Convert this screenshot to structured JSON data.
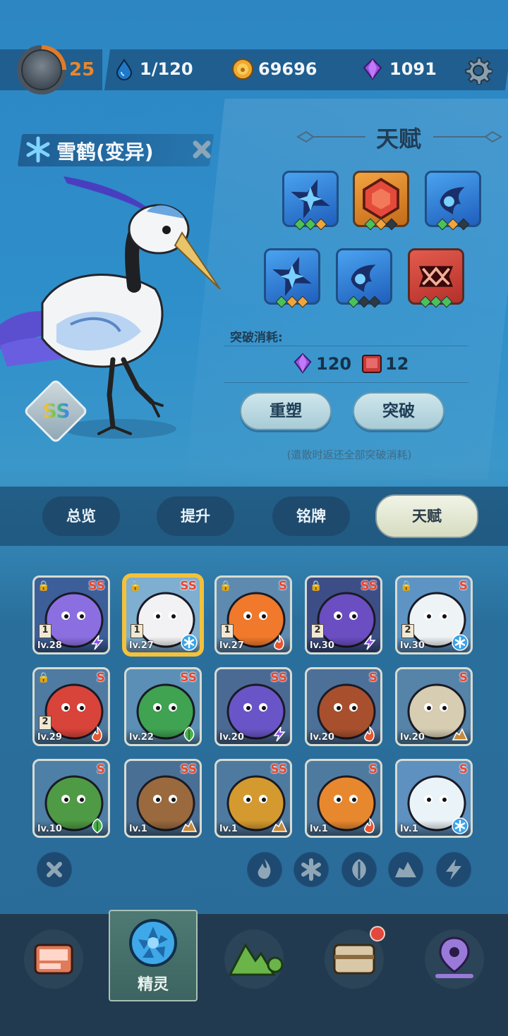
{
  "player": {
    "level": "25"
  },
  "resources": {
    "stamina": "1/120",
    "coins": "69696",
    "gems": "1091"
  },
  "spirit": {
    "name": "雪鹤(变异)",
    "rank": "SS"
  },
  "talent": {
    "title": "天赋",
    "icons": [
      {
        "type": "blue-star",
        "color": "blue",
        "pips": [
          "#4cc15a",
          "#4cc15a",
          "#f0a53a"
        ]
      },
      {
        "type": "gem",
        "color": "orange",
        "pips": [
          "#4cc15a",
          "#f0a53a",
          "#2d3a44"
        ]
      },
      {
        "type": "claw",
        "color": "blue",
        "pips": [
          "#4cc15a",
          "#f0a53a",
          "#2d3a44"
        ]
      },
      {
        "type": "blue-star",
        "color": "blue",
        "pips": [
          "#4cc15a",
          "#f0a53a",
          "#f0a53a"
        ]
      },
      {
        "type": "claw",
        "color": "blue",
        "pips": [
          "#4cc15a",
          "#2d3a44",
          "#2d3a44"
        ]
      },
      {
        "type": "fang",
        "color": "red",
        "pips": [
          "#4cc15a",
          "#4cc15a",
          "#4cc15a"
        ]
      }
    ],
    "cost_label": "突破消耗:",
    "cost_gems": "120",
    "cost_books": "12",
    "reshape_label": "重塑",
    "breakthrough_label": "突破",
    "note": "(遣散时返还全部突破消耗)"
  },
  "tabs": {
    "overview": "总览",
    "upgrade": "提升",
    "plate": "铭牌",
    "talent": "天赋"
  },
  "cards": [
    {
      "name": "jellyfish",
      "grade": "SS",
      "level": "lv.28",
      "stars": "1",
      "locked": true,
      "element": "electric",
      "bg": "#3c5f9a",
      "art": "#8b6fe0"
    },
    {
      "name": "snow-crane",
      "grade": "SS",
      "level": "lv.27",
      "stars": "1",
      "locked": true,
      "element": "ice",
      "bg": "#7eaed0",
      "art": "#f2f2f4",
      "selected": true
    },
    {
      "name": "flame-spirit",
      "grade": "S",
      "level": "lv.27",
      "stars": "1",
      "locked": true,
      "element": "fire",
      "bg": "#5f8ab0",
      "art": "#f0792c"
    },
    {
      "name": "shadow-cat",
      "grade": "SS",
      "level": "lv.30",
      "stars": "2",
      "locked": true,
      "element": "electric",
      "bg": "#3d4e86",
      "art": "#6a4ec2"
    },
    {
      "name": "snow-owl",
      "grade": "S",
      "level": "lv.30",
      "stars": "2",
      "locked": true,
      "element": "ice",
      "bg": "#5d94c4",
      "art": "#eef3f6"
    },
    {
      "name": "horn-blob",
      "grade": "S",
      "level": "lv.29",
      "stars": "2",
      "locked": true,
      "element": "fire",
      "bg": "#4f7ba2",
      "art": "#d8433a"
    },
    {
      "name": "parrot",
      "grade": "SS",
      "level": "lv.22",
      "stars": "",
      "locked": false,
      "element": "grass",
      "bg": "#5b8fb5",
      "art": "#3fa352"
    },
    {
      "name": "cannon",
      "grade": "SS",
      "level": "lv.20",
      "stars": "",
      "locked": false,
      "element": "electric",
      "bg": "#4a6a94",
      "art": "#6a55c8"
    },
    {
      "name": "steam-robot",
      "grade": "S",
      "level": "lv.20",
      "stars": "",
      "locked": false,
      "element": "fire",
      "bg": "#4d7098",
      "art": "#a8502e"
    },
    {
      "name": "rock-beast",
      "grade": "S",
      "level": "lv.20",
      "stars": "",
      "locked": false,
      "element": "earth",
      "bg": "#5683a8",
      "art": "#d6cdb2"
    },
    {
      "name": "cactus",
      "grade": "S",
      "level": "lv.10",
      "stars": "",
      "locked": false,
      "element": "grass",
      "bg": "#4e7fa6",
      "art": "#4f9a44"
    },
    {
      "name": "owl-cat",
      "grade": "SS",
      "level": "lv.1",
      "stars": "",
      "locked": false,
      "element": "earth",
      "bg": "#4a6f94",
      "art": "#9a6a3e"
    },
    {
      "name": "sunflower",
      "grade": "SS",
      "level": "lv.1",
      "stars": "",
      "locked": false,
      "element": "earth",
      "bg": "#4e7aa0",
      "art": "#d49a30"
    },
    {
      "name": "lava-slime",
      "grade": "S",
      "level": "lv.1",
      "stars": "",
      "locked": false,
      "element": "fire",
      "bg": "#4f7aa0",
      "art": "#e8882e"
    },
    {
      "name": "ice-fox",
      "grade": "S",
      "level": "lv.1",
      "stars": "",
      "locked": false,
      "element": "ice",
      "bg": "#5e90c0",
      "art": "#eaf3f8"
    }
  ],
  "nav": {
    "active_label": "精灵"
  },
  "colors": {
    "accent": "#e8862e",
    "tab_active": "#f1f4e6",
    "fire": "#e8552e",
    "ice": "#3aa3e8",
    "electric": "#8a4ee8",
    "grass": "#49b04c",
    "earth": "#c88a3a"
  }
}
